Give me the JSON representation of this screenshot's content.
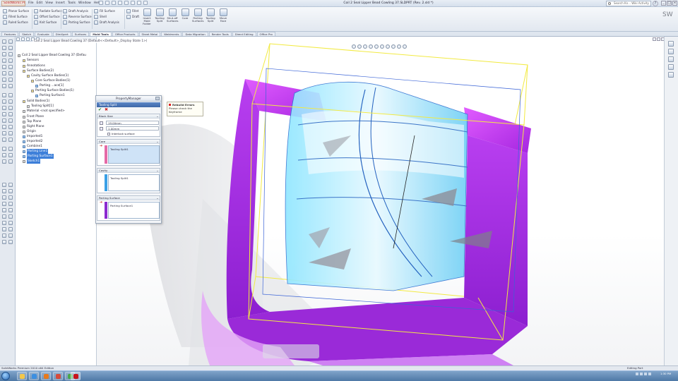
{
  "titlebar": {
    "app_name": "SolidWorks Pre",
    "menus": [
      "File",
      "Edit",
      "View",
      "Insert",
      "Tools",
      "Window",
      "Help"
    ],
    "document_title": "Coil 2 Seal Lipper Bead Cowling 37.SLDPRT (Rev. 2.sld *)",
    "search_placeholder": "Search Kn... Wiki Activity",
    "help": "?",
    "min": "_",
    "max": "□",
    "close": "×"
  },
  "ribbon": {
    "group1": [
      "Planar Surface",
      "Filled Surface",
      "Ruled Surface"
    ],
    "group2": [
      "Radiate Surface",
      "Offset Surface",
      "Knit Surface"
    ],
    "group3": [
      "Draft Analysis",
      "Reverse Surface",
      "Parting Surface"
    ],
    "group4": [
      "Fill Surface",
      "Shell",
      "Draft Analysis"
    ],
    "group5": [
      "Fillet",
      "Draft"
    ],
    "big_buttons": [
      "Insert Mold Folder",
      "Tooling Split",
      "Shut-off Surfaces",
      "Core",
      "Parting Surfaces",
      "Tooling Split",
      "Move Face"
    ],
    "brand": "SW"
  },
  "tabs": [
    "Features",
    "Sketch",
    "Evaluate",
    "DimXpert",
    "Surfaces",
    "Mold Tools",
    "Office Products",
    "Sheet Metal",
    "Weldments",
    "Data Migration",
    "Render Tools",
    "Direct Editing",
    "Office Pro"
  ],
  "active_tab": "Mold Tools",
  "tree": {
    "items": [
      {
        "label": "Coil 2 Seal Lipper Bead Cowling 37 (Defau",
        "sel": false
      },
      {
        "label": "Sensors",
        "sel": false
      },
      {
        "label": "Annotations",
        "sel": false
      },
      {
        "label": "Surface Bodies(2)",
        "sel": false
      },
      {
        "label": "Cavity Surface Bodies(1)",
        "sel": false
      },
      {
        "label": "Core Surface Bodies(1)",
        "sel": false
      },
      {
        "label": "Parting ...ace[1]",
        "sel": false
      },
      {
        "label": "Parting Surface Bodies(1)",
        "sel": false
      },
      {
        "label": "Parting Surface1",
        "sel": false
      },
      {
        "label": "Solid Bodies(1)",
        "sel": false
      },
      {
        "label": "Tooling Split[1]",
        "sel": false
      },
      {
        "label": "Material <not specified>",
        "sel": false
      },
      {
        "label": "Front Plane",
        "sel": false
      },
      {
        "label": "Top Plane",
        "sel": false
      },
      {
        "label": "Right Plane",
        "sel": false
      },
      {
        "label": "Origin",
        "sel": false
      },
      {
        "label": "Imported1",
        "sel": false
      },
      {
        "label": "Imported2",
        "sel": false
      },
      {
        "label": "Combine1",
        "sel": false
      },
      {
        "label": "Parting Line1",
        "sel": true
      },
      {
        "label": "Parting Surface1",
        "sel": true
      },
      {
        "label": "Sketch1",
        "sel": true
      }
    ]
  },
  "document_name": "Coil 2 Seal Lipper Bead Cowling 37 (Default<<Default>_Display State 1>)",
  "property_manager": {
    "title": "PropertyManager",
    "feature": "Tooling Split",
    "block_size_header": "Block Size",
    "depth1": "19.00mm",
    "depth2": "1.00mm",
    "interlock_label": "Interlock surface",
    "core_header": "Core",
    "core_item": "Tooling Split1",
    "cavity_header": "Cavity",
    "cavity_item": "Tooling Split1",
    "parting_header": "Parting Surface",
    "parting_item": "Parting Surface1"
  },
  "tooltip": {
    "title": "Rebuild Errors",
    "line1": "Please check the",
    "line2": "Keyframe"
  },
  "status": {
    "left": "SolidWorks Premium 2010 x64 Edition",
    "right": "Editing Part"
  },
  "taskbar": {
    "clock": "1:30 PM"
  },
  "colors": {
    "mold_magenta": "#b733ee",
    "glass_cyan": "#7fd8f7",
    "bbox_yellow": "#f2ea42",
    "selection_blue": "#3d7fd9"
  }
}
